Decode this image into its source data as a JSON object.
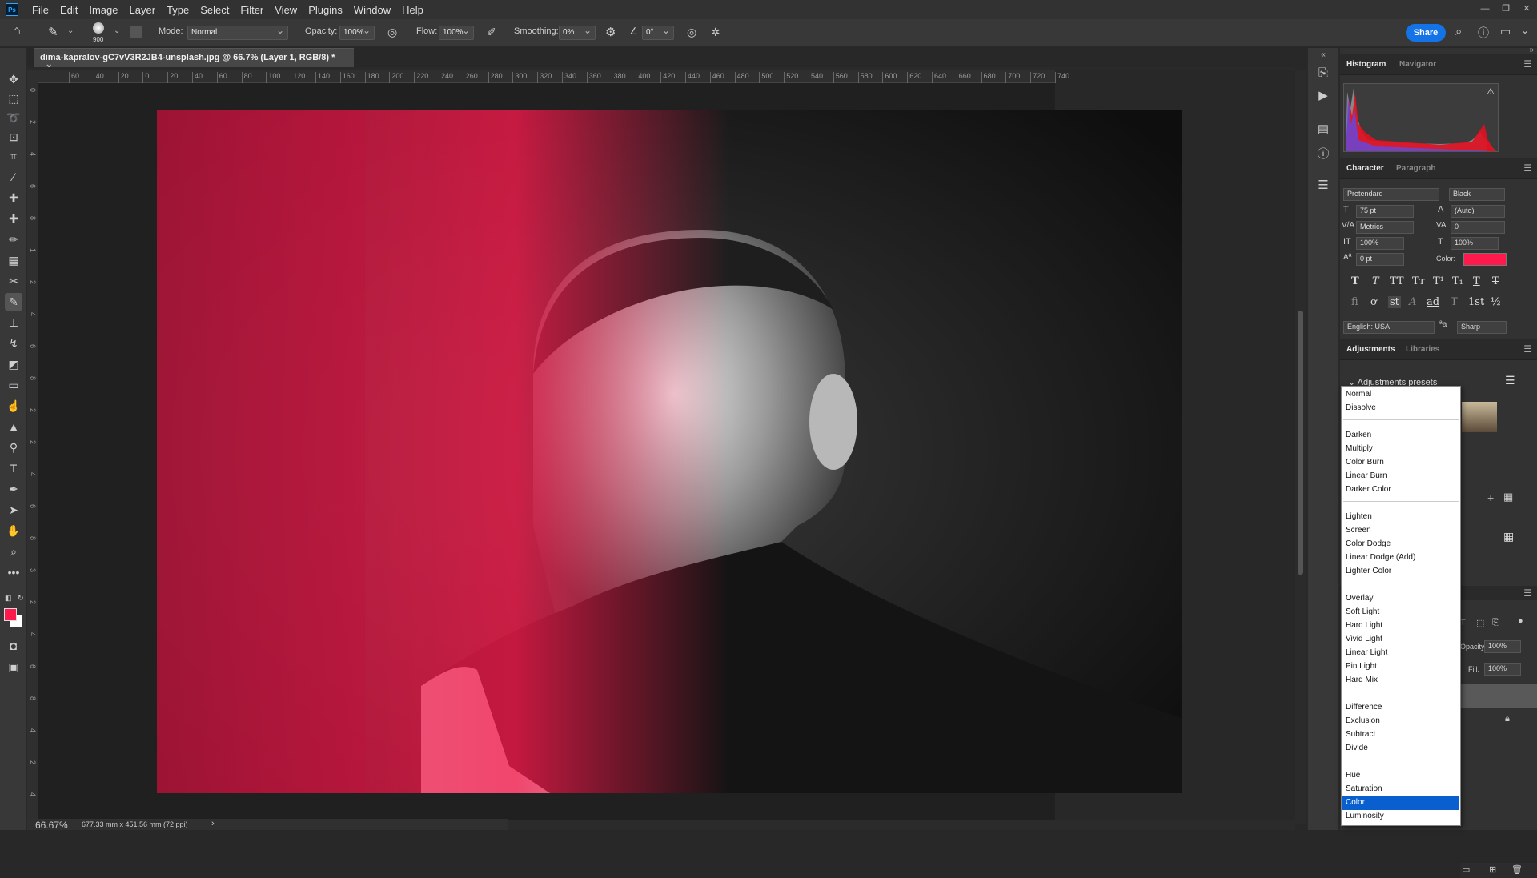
{
  "menu": {
    "app_icon": "Ps",
    "items": [
      "File",
      "Edit",
      "Image",
      "Layer",
      "Type",
      "Select",
      "Filter",
      "View",
      "Plugins",
      "Window",
      "Help"
    ]
  },
  "options": {
    "brush_size": "900",
    "mode_label": "Mode:",
    "mode_value": "Normal",
    "opacity_label": "Opacity:",
    "opacity_value": "100%",
    "flow_label": "Flow:",
    "flow_value": "100%",
    "smoothing_label": "Smoothing:",
    "smoothing_value": "0%",
    "angle_value": "0°",
    "share_label": "Share"
  },
  "document": {
    "tab_title": "dima-kapralov-gC7vV3R2JB4-unsplash.jpg @ 66.7% (Layer 1, RGB/8) *",
    "close": "×"
  },
  "ruler_h": [
    "60",
    "40",
    "20",
    "0",
    "20",
    "40",
    "60",
    "80",
    "100",
    "120",
    "140",
    "160",
    "180",
    "200",
    "220",
    "240",
    "260",
    "280",
    "300",
    "320",
    "340",
    "360",
    "380",
    "400",
    "420",
    "440",
    "460",
    "480",
    "500",
    "520",
    "540",
    "560",
    "580",
    "600",
    "620",
    "640",
    "660",
    "680",
    "700",
    "720",
    "740"
  ],
  "ruler_v": [
    "0",
    "2",
    "4",
    "6",
    "8",
    "1",
    "2",
    "4",
    "6",
    "8",
    "2",
    "2",
    "4",
    "6",
    "8",
    "3",
    "2",
    "4",
    "6",
    "8",
    "4",
    "2",
    "4"
  ],
  "status": {
    "zoom": "66.67%",
    "size": "677.33 mm x 451.56 mm (72 ppi)",
    "arrow": "›"
  },
  "panels": {
    "histogram": {
      "tab1": "Histogram",
      "tab2": "Navigator"
    },
    "character": {
      "tab1": "Character",
      "tab2": "Paragraph",
      "font_family": "Pretendard",
      "font_style": "Black",
      "size": "75 pt",
      "leading": "(Auto)",
      "kerning": "Metrics",
      "tracking": "0",
      "vscale": "100%",
      "hscale": "100%",
      "baseline": "0 pt",
      "color_label": "Color:",
      "color": "#ff1a4e",
      "language": "English: USA",
      "aa_label": "ªa",
      "antialias": "Sharp"
    },
    "adjustments": {
      "tab1": "Adjustments",
      "tab2": "Libraries",
      "presets_label": "Adjustments presets"
    },
    "layers": {
      "opacity_label": "Opacity:",
      "opacity": "100%",
      "fill_label": "Fill:",
      "fill": "100%"
    }
  },
  "blend_modes": [
    [
      "Normal",
      "Dissolve"
    ],
    [
      "Darken",
      "Multiply",
      "Color Burn",
      "Linear Burn",
      "Darker Color"
    ],
    [
      "Lighten",
      "Screen",
      "Color Dodge",
      "Linear Dodge (Add)",
      "Lighter Color"
    ],
    [
      "Overlay",
      "Soft Light",
      "Hard Light",
      "Vivid Light",
      "Linear Light",
      "Pin Light",
      "Hard Mix"
    ],
    [
      "Difference",
      "Exclusion",
      "Subtract",
      "Divide"
    ],
    [
      "Hue",
      "Saturation",
      "Color",
      "Luminosity"
    ]
  ],
  "blend_selected": "Color",
  "colors": {
    "accent": "#1473e6",
    "foreground": "#ff1a4e",
    "background": "#ffffff",
    "selection": "#0a5fce"
  }
}
